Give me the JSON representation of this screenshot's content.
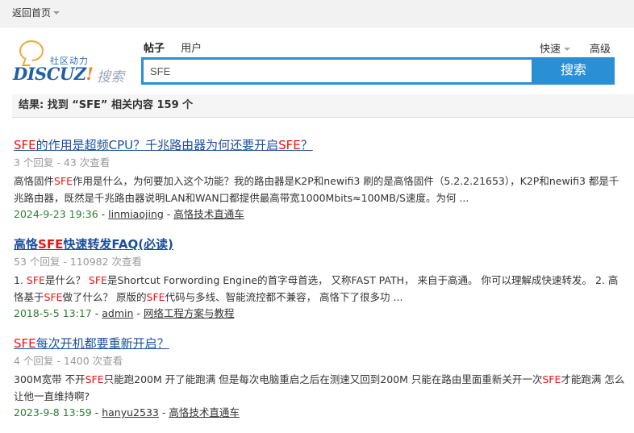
{
  "topbar": {
    "back_label": "返回首页"
  },
  "logo": {
    "sub": "社区动力",
    "brand_main": "DISCUZ",
    "brand_bang": "!",
    "search_word": "搜索"
  },
  "tabs": [
    {
      "label": "帖子",
      "active": true
    },
    {
      "label": "用户",
      "active": false
    }
  ],
  "quick_label": "快速",
  "advanced_label": "高级",
  "search": {
    "value": "SFE",
    "button_label": "搜索"
  },
  "summary": "结果: 找到 “SFE” 相关内容 159 个",
  "colors": {
    "accent": "#2a8fd4",
    "highlight": "#ee1111",
    "link": "#1c4f9c",
    "date": "#2e7d32"
  },
  "results": [
    {
      "title_hl1": "SFE",
      "title_mid": "的作用是超频CPU？千兆路由器为何还要开启",
      "title_hl2": "SFE",
      "title_end": "？",
      "meta": "3 个回复 - 43 次查看",
      "desc_pre": "高恪固件",
      "desc_hl": "SFE",
      "desc_post": "作用是什么，为何要加入这个功能？我的路由器是K2P和newifi3 刷的是高恪固件（5.2.2.21653），K2P和newifi3 都是千兆路由器，既然是千兆路由器说明LAN和WAN口都提供最高带宽1000Mbits≈100MB/S速度。为何 ...",
      "date": "2024-9-23 19:36",
      "author": "linmiaojing",
      "forum": "高恪技术直通车"
    },
    {
      "title_pre": "高恪",
      "title_hl": "SFE",
      "title_post": "快速转发FAQ(必读)",
      "meta": "53 个回复 - 110982 次查看",
      "d1": "1. ",
      "d_hl1": "SFE",
      "d2": "是什么？ ",
      "d_hl2": "SFE",
      "d3": "是Shortcut Forwording Engine的首字母首选， 又称FAST PATH， 来自于高通。 你可以理解成快速转发。 2. 高恪基于",
      "d_hl3": "SFE",
      "d4": "做了什么？ 原版的",
      "d_hl4": "SFE",
      "d5": "代码与多线、智能流控都不兼容， 高恪下了很多功 ...",
      "date": "2018-5-5 13:17",
      "author": "admin",
      "forum": "网络工程方案与教程"
    },
    {
      "title_hl": "SFE",
      "title_post": "每次开机都要重新开启？",
      "meta": "4 个回复 - 1400 次查看",
      "d1": "300M宽带 不开",
      "d_hl1": "SFE",
      "d2": "只能跑200M 开了能跑满 但是每次电脑重启之后在测速又回到200M 只能在路由里面重新关开一次",
      "d_hl2": "SFE",
      "d3": "才能跑满 怎么让他一直维持啊?",
      "date": "2023-9-8 13:59",
      "author": "hanyu2533",
      "forum": "高恪技术直通车"
    }
  ]
}
